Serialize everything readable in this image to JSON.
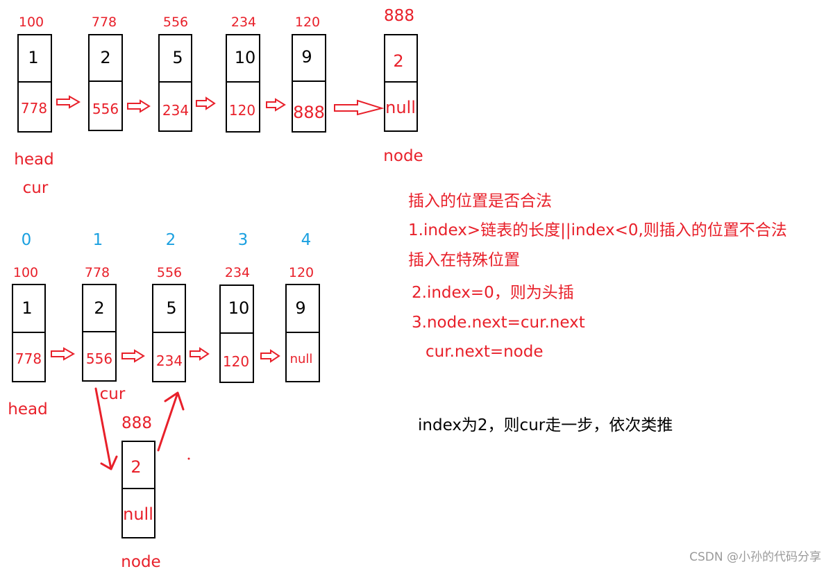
{
  "diagram": {
    "top_list": {
      "nodes": [
        {
          "address": "100",
          "value": "1",
          "next": "778"
        },
        {
          "address": "778",
          "value": "2",
          "next": "556"
        },
        {
          "address": "556",
          "value": "5",
          "next": "234"
        },
        {
          "address": "234",
          "value": "10",
          "next": "120"
        },
        {
          "address": "120",
          "value": "9",
          "next": "888"
        }
      ],
      "new_node": {
        "address": "888",
        "value": "2",
        "next": "null",
        "label": "node"
      },
      "pointer_labels": [
        "head",
        "cur"
      ]
    },
    "bottom_list": {
      "indices": [
        "0",
        "1",
        "2",
        "3",
        "4"
      ],
      "nodes": [
        {
          "address": "100",
          "value": "1",
          "next": "778"
        },
        {
          "address": "778",
          "value": "2",
          "next": "556"
        },
        {
          "address": "556",
          "value": "5",
          "next": "234"
        },
        {
          "address": "234",
          "value": "10",
          "next": "120"
        },
        {
          "address": "120",
          "value": "9",
          "next": "null"
        }
      ],
      "head_label": "head",
      "cur_label": "cur",
      "new_node": {
        "address": "888",
        "value": "2",
        "next": "null",
        "label": "node"
      }
    },
    "notes": {
      "title": "插入的位置是否合法",
      "rule1": "1.index>链表的长度||index<0,则插入的位置不合法",
      "special": "插入在特殊位置",
      "rule2": "2.index=0，则为头插",
      "rule3a": "3.node.next=cur.next",
      "rule3b": "cur.next=node",
      "example": "index为2，则cur走一步，依次类推"
    },
    "watermark": "CSDN @小孙的代码分享",
    "colors": {
      "accent": "#e8202a",
      "index": "#1aa0e0",
      "text": "#000000"
    }
  }
}
